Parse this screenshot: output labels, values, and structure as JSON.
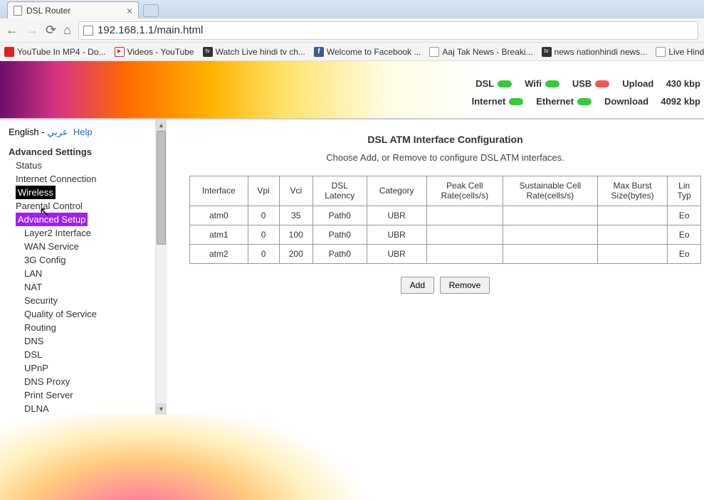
{
  "browser": {
    "tab_title": "DSL Router",
    "url": "192.168.1.1/main.html",
    "bookmarks": [
      {
        "label": "YouTube In MP4 - Do...",
        "icon": "bm-red"
      },
      {
        "label": "Videos - YouTube",
        "icon": "bm-yt"
      },
      {
        "label": "Watch Live hindi tv ch...",
        "icon": "bm-tv"
      },
      {
        "label": "Welcome to Facebook ...",
        "icon": "bm-fb"
      },
      {
        "label": "Aaj Tak News - Breaki...",
        "icon": "bm-doc"
      },
      {
        "label": "news nationhindi news...",
        "icon": "bm-tv"
      },
      {
        "label": "Live Hindi News: Wa",
        "icon": "bm-doc"
      }
    ]
  },
  "status": {
    "row1": [
      {
        "label": "DSL",
        "led": "green"
      },
      {
        "label": "Wifi",
        "led": "green"
      },
      {
        "label": "USB",
        "led": "red"
      }
    ],
    "row2": [
      {
        "label": "Internet",
        "led": "green"
      },
      {
        "label": "Ethernet",
        "led": "green"
      }
    ],
    "upload_label": "Upload",
    "upload_value": "430 kbp",
    "download_label": "Download",
    "download_value": "4092 kbp"
  },
  "sidebar": {
    "lang_english": "English",
    "lang_sep": " - ",
    "lang_arabic": "عربي",
    "help": "Help",
    "title": "Advanced Settings",
    "items": [
      {
        "label": "Status",
        "level": 1
      },
      {
        "label": "Internet Connection",
        "level": 1
      },
      {
        "label": "Wireless",
        "level": 1,
        "style": "active-wireless"
      },
      {
        "label": "Parental Control",
        "level": 1
      },
      {
        "label": "Advanced Setup",
        "level": 1,
        "style": "active-advanced"
      },
      {
        "label": "Layer2 Interface",
        "level": 2
      },
      {
        "label": "WAN Service",
        "level": 2
      },
      {
        "label": "3G Config",
        "level": 2
      },
      {
        "label": "LAN",
        "level": 2
      },
      {
        "label": "NAT",
        "level": 2
      },
      {
        "label": "Security",
        "level": 2
      },
      {
        "label": "Quality of Service",
        "level": 2
      },
      {
        "label": "Routing",
        "level": 2
      },
      {
        "label": "DNS",
        "level": 2
      },
      {
        "label": "DSL",
        "level": 2
      },
      {
        "label": "UPnP",
        "level": 2
      },
      {
        "label": "DNS Proxy",
        "level": 2
      },
      {
        "label": "Print Server",
        "level": 2
      },
      {
        "label": "DLNA",
        "level": 2
      }
    ]
  },
  "content": {
    "heading": "DSL ATM Interface Configuration",
    "subtitle": "Choose Add, or Remove to configure DSL ATM interfaces.",
    "columns": [
      "Interface",
      "Vpi",
      "Vci",
      "DSL Latency",
      "Category",
      "Peak Cell Rate(cells/s)",
      "Sustainable Cell Rate(cells/s)",
      "Max Burst Size(bytes)",
      "Lin Typ"
    ],
    "rows": [
      {
        "interface": "atm0",
        "vpi": "0",
        "vci": "35",
        "latency": "Path0",
        "category": "UBR",
        "peak": "",
        "sustain": "",
        "burst": "",
        "link": "Eo"
      },
      {
        "interface": "atm1",
        "vpi": "0",
        "vci": "100",
        "latency": "Path0",
        "category": "UBR",
        "peak": "",
        "sustain": "",
        "burst": "",
        "link": "Eo"
      },
      {
        "interface": "atm2",
        "vpi": "0",
        "vci": "200",
        "latency": "Path0",
        "category": "UBR",
        "peak": "",
        "sustain": "",
        "burst": "",
        "link": "Eo"
      }
    ],
    "add_btn": "Add",
    "remove_btn": "Remove"
  }
}
